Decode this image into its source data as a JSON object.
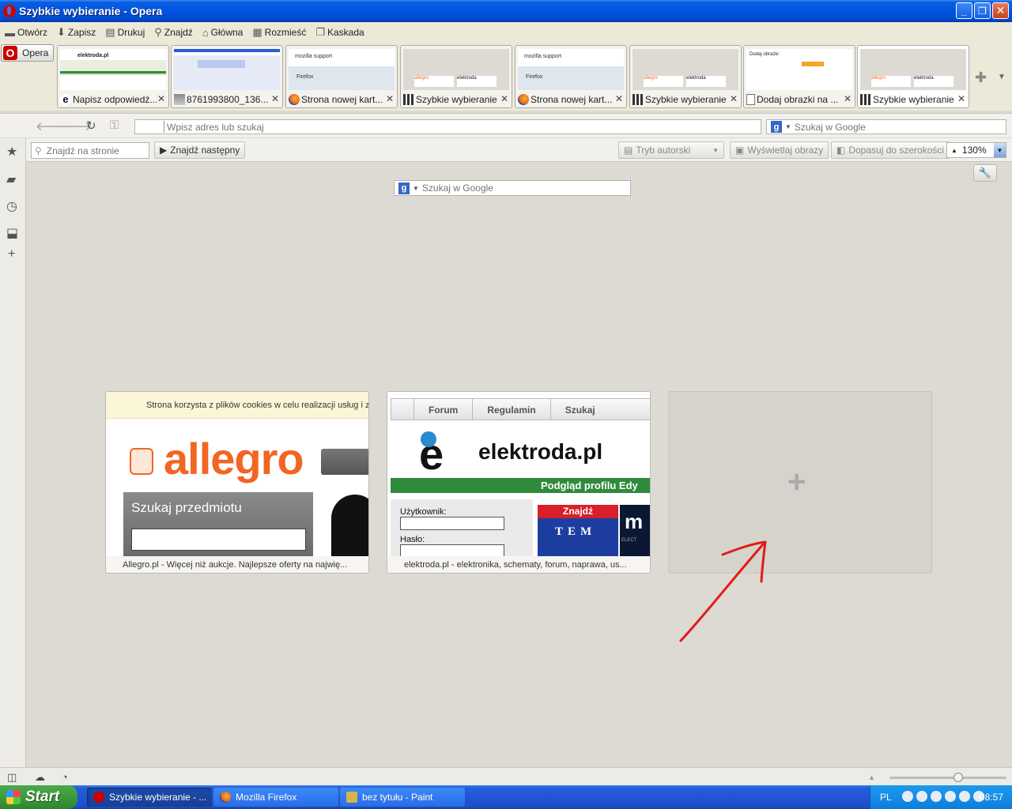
{
  "window": {
    "title": "Szybkie wybieranie - Opera",
    "controls": {
      "minimize": "_",
      "maximize": "❐",
      "close": "✕"
    }
  },
  "menubar": {
    "items": [
      {
        "label": "Otwórz",
        "icon": "folder-icon"
      },
      {
        "label": "Zapisz",
        "icon": "save-icon"
      },
      {
        "label": "Drukuj",
        "icon": "print-icon"
      },
      {
        "label": "Znajdź",
        "icon": "magnifier-icon"
      },
      {
        "label": "Główna",
        "icon": "home-icon"
      },
      {
        "label": "Rozmieść",
        "icon": "tile-icon"
      },
      {
        "label": "Kaskada",
        "icon": "cascade-icon"
      }
    ]
  },
  "opera_button": {
    "label": "Opera",
    "glyph": "O"
  },
  "tabs": [
    {
      "label": "Napisz odpowiedź...",
      "icon": "ie-icon"
    },
    {
      "label": "8761993800_136...",
      "icon": "image-icon"
    },
    {
      "label": "Strona nowej kart...",
      "icon": "firefox-icon"
    },
    {
      "label": "Szybkie wybieranie",
      "icon": "speed-dial-icon"
    },
    {
      "label": "Strona nowej kart...",
      "icon": "firefox-icon"
    },
    {
      "label": "Szybkie wybieranie",
      "icon": "speed-dial-icon"
    },
    {
      "label": "Dodaj obrazki na ...",
      "icon": "document-icon"
    },
    {
      "label": "Szybkie wybieranie",
      "icon": "speed-dial-icon"
    }
  ],
  "tab_close": "✕",
  "tab_thumbs": {
    "elektroda": "elektroda.pl",
    "mozilla": "mozilla support",
    "firefox": "Firefox",
    "allegro": "allegro",
    "elektroda_short": "elektroda",
    "dodaj": "Dodaj obrazki"
  },
  "address_bar": {
    "placeholder": "Wpisz adres lub szukaj",
    "search_placeholder": "Szukaj w Google",
    "search_engine_glyph": "g"
  },
  "find_bar": {
    "placeholder": "Znajdź na stronie",
    "find_next": "Znajdź następny",
    "author_mode": "Tryb autorski",
    "show_images": "Wyświetlaj obrazy",
    "fit_width": "Dopasuj do szerokości",
    "zoom": "130%"
  },
  "speed_dial": {
    "search_placeholder": "Szukaj w Google",
    "search_engine_glyph": "g",
    "dials": [
      {
        "caption": "Allegro.pl - Więcej niż aukcje. Najlepsze oferty na najwię...",
        "cookie_notice": "Strona korzysta z plików cookies w celu realizacji usług i z",
        "logo": "allegro",
        "search_label": "Szukaj przedmiotu"
      },
      {
        "caption": "elektroda.pl - elektronika, schematy, forum, naprawa, us...",
        "nav": [
          "Forum",
          "Regulamin",
          "Szukaj"
        ],
        "logo_e": "e",
        "logo_text": "elektroda.pl",
        "green_bar": "Podgląd profilu   Edy",
        "user_label": "Użytkownik:",
        "pass_label": "Hasło:",
        "find_label": "Znajdź",
        "tem_logo": "TEM",
        "dark_text": "m",
        "dark_subtext": "ELECT"
      }
    ],
    "add_label": "+"
  },
  "taskbar": {
    "start": "Start",
    "tasks": [
      {
        "label": "Szybkie wybieranie - ...",
        "color": "#cc0000",
        "active": true
      },
      {
        "label": "Mozilla Firefox",
        "color": "#e3611c",
        "active": false
      },
      {
        "label": "bez tytułu - Paint",
        "color": "#d9b44a",
        "active": false
      }
    ],
    "lang": "PL",
    "clock": "08:57"
  }
}
